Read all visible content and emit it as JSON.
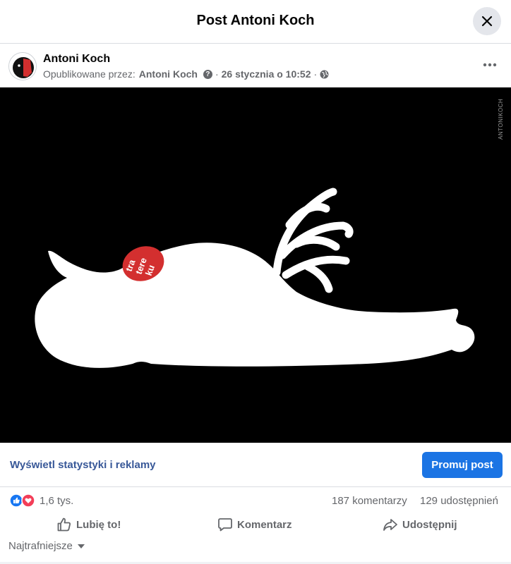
{
  "header": {
    "title": "Post Antoni Koch"
  },
  "post": {
    "author": "Antoni Koch",
    "published_by_label": "Opublikowane przez:",
    "published_by_name": "Antoni Koch",
    "separator": "·",
    "date": "26 stycznia o 10:52",
    "image_watermark": "ANTONIKOCH",
    "image_badge_lines": [
      "tra",
      "tere",
      "ku"
    ]
  },
  "promo": {
    "stats_link": "Wyświetl statystyki i reklamy",
    "promote_button": "Promuj post"
  },
  "engagement": {
    "reactions_count": "1,6 tys.",
    "comments": "187 komentarzy",
    "shares": "129 udostępnień"
  },
  "actions": {
    "like": "Lubię to!",
    "comment": "Komentarz",
    "share": "Udostępnij"
  },
  "comments_sort": {
    "label": "Najtrafniejsze"
  },
  "colors": {
    "accent": "#1b74e4",
    "link": "#385898",
    "secondary_text": "#65676b",
    "like_blue": "#1877f2",
    "love_red": "#f33e58",
    "badge_red": "#d32f2f"
  },
  "icons": {
    "close": "close-icon",
    "more": "more-icon",
    "help": "help-icon",
    "privacy": "globe-icon",
    "like": "thumbs-up-icon",
    "comment": "comment-bubble-icon",
    "share": "share-arrow-icon",
    "sort": "caret-down-icon"
  }
}
